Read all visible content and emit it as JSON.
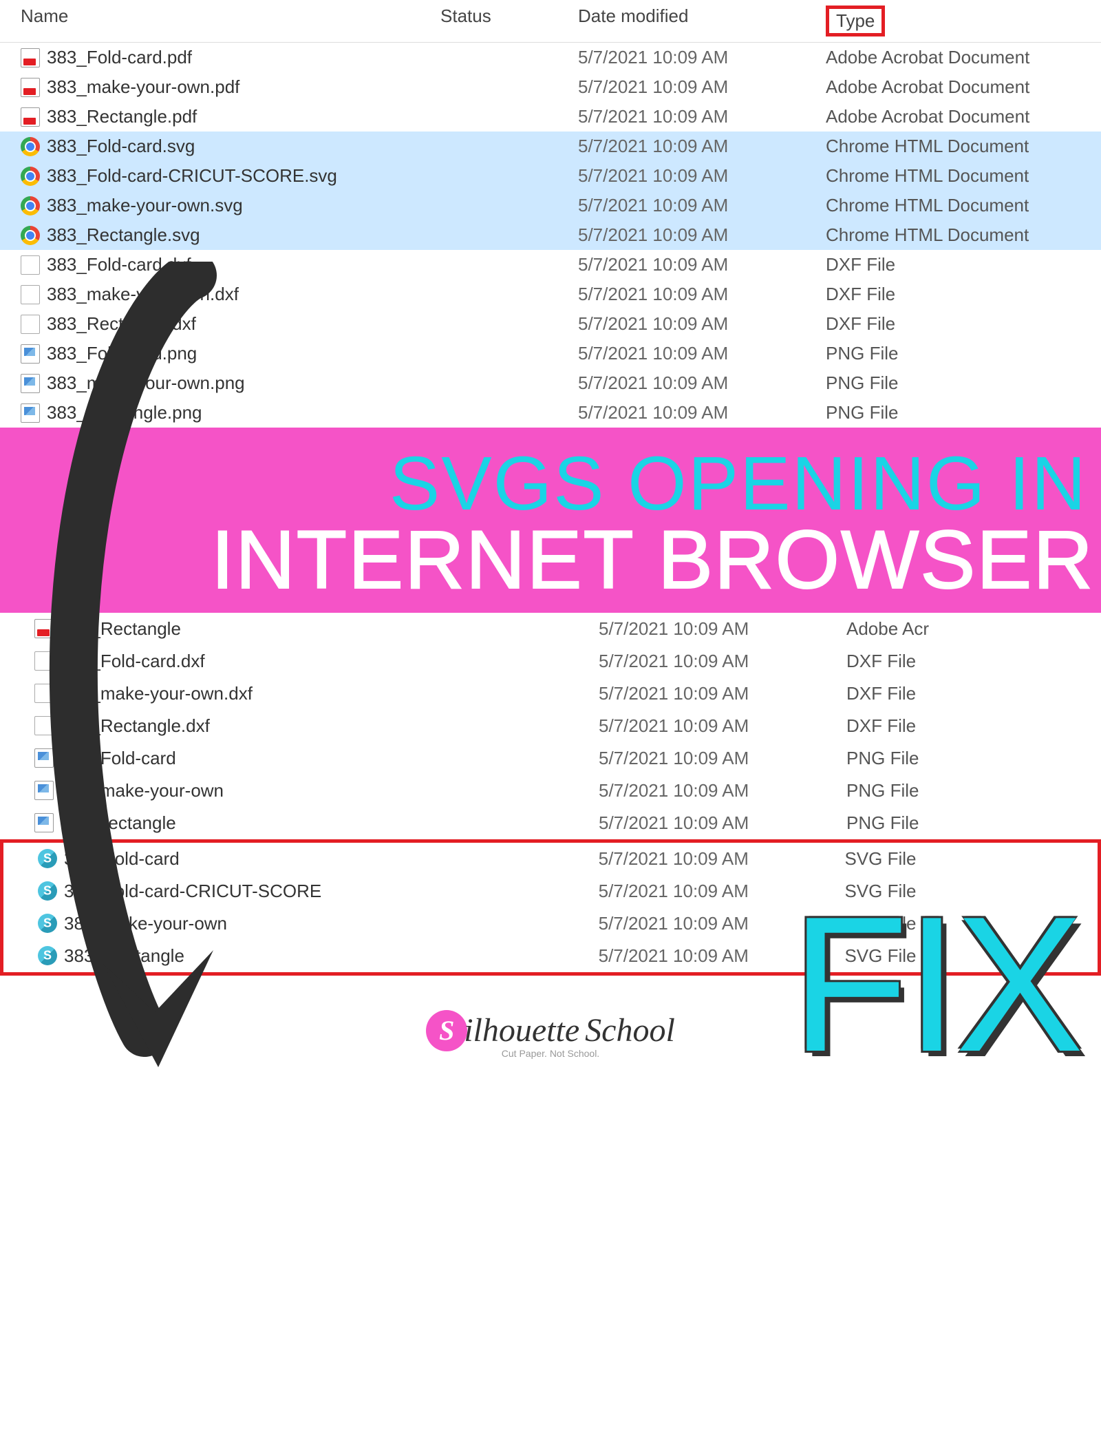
{
  "headers": {
    "name": "Name",
    "status": "Status",
    "date": "Date modified",
    "type": "Type"
  },
  "top_files": [
    {
      "icon": "pdf",
      "name": "383_Fold-card.pdf",
      "date": "5/7/2021 10:09 AM",
      "type": "Adobe Acrobat Document",
      "selected": false
    },
    {
      "icon": "pdf",
      "name": "383_make-your-own.pdf",
      "date": "5/7/2021 10:09 AM",
      "type": "Adobe Acrobat Document",
      "selected": false
    },
    {
      "icon": "pdf",
      "name": "383_Rectangle.pdf",
      "date": "5/7/2021 10:09 AM",
      "type": "Adobe Acrobat Document",
      "selected": false
    },
    {
      "icon": "chrome",
      "name": "383_Fold-card.svg",
      "date": "5/7/2021 10:09 AM",
      "type": "Chrome HTML Document",
      "selected": true
    },
    {
      "icon": "chrome",
      "name": "383_Fold-card-CRICUT-SCORE.svg",
      "date": "5/7/2021 10:09 AM",
      "type": "Chrome HTML Document",
      "selected": true
    },
    {
      "icon": "chrome",
      "name": "383_make-your-own.svg",
      "date": "5/7/2021 10:09 AM",
      "type": "Chrome HTML Document",
      "selected": true
    },
    {
      "icon": "chrome",
      "name": "383_Rectangle.svg",
      "date": "5/7/2021 10:09 AM",
      "type": "Chrome HTML Document",
      "selected": true
    },
    {
      "icon": "blank",
      "name": "383_Fold-card.dxf",
      "date": "5/7/2021 10:09 AM",
      "type": "DXF File",
      "selected": false
    },
    {
      "icon": "blank",
      "name": "383_make-your-own.dxf",
      "date": "5/7/2021 10:09 AM",
      "type": "DXF File",
      "selected": false
    },
    {
      "icon": "blank",
      "name": "383_Rectangle.dxf",
      "date": "5/7/2021 10:09 AM",
      "type": "DXF File",
      "selected": false
    },
    {
      "icon": "png",
      "name": "383_Fold-card.png",
      "date": "5/7/2021 10:09 AM",
      "type": "PNG File",
      "selected": false
    },
    {
      "icon": "png",
      "name": "383_make-your-own.png",
      "date": "5/7/2021 10:09 AM",
      "type": "PNG File",
      "selected": false
    },
    {
      "icon": "png",
      "name": "383_Rectangle.png",
      "date": "5/7/2021 10:09 AM",
      "type": "PNG File",
      "selected": false
    }
  ],
  "banner": {
    "line1": "SVGS OPENING IN",
    "line2": "INTERNET BROWSER",
    "fix": "FIX"
  },
  "bottom_files_upper": [
    {
      "icon": "pdf",
      "name": "383_Rectangle",
      "date": "5/7/2021 10:09 AM",
      "type": "Adobe Acr"
    },
    {
      "icon": "blank",
      "name": "383_Fold-card.dxf",
      "date": "5/7/2021 10:09 AM",
      "type": "DXF File"
    },
    {
      "icon": "blank",
      "name": "383_make-your-own.dxf",
      "date": "5/7/2021 10:09 AM",
      "type": "DXF File"
    },
    {
      "icon": "blank",
      "name": "383_Rectangle.dxf",
      "date": "5/7/2021 10:09 AM",
      "type": "DXF File"
    },
    {
      "icon": "png",
      "name": "383_Fold-card",
      "date": "5/7/2021 10:09 AM",
      "type": "PNG File"
    },
    {
      "icon": "png",
      "name": "383_make-your-own",
      "date": "5/7/2021 10:09 AM",
      "type": "PNG File"
    },
    {
      "icon": "png",
      "name": "383 Rectangle",
      "date": "5/7/2021 10:09 AM",
      "type": "PNG File"
    }
  ],
  "bottom_files_boxed": [
    {
      "icon": "svg",
      "name": "383_Fold-card",
      "date": "5/7/2021 10:09 AM",
      "type": "SVG File"
    },
    {
      "icon": "svg",
      "name": "383_Fold-card-CRICUT-SCORE",
      "date": "5/7/2021 10:09 AM",
      "type": "SVG File"
    },
    {
      "icon": "svg",
      "name": "383_make-your-own",
      "date": "5/7/2021 10:09 AM",
      "type": "SVG File"
    },
    {
      "icon": "svg",
      "name": "383_Rectangle",
      "date": "5/7/2021 10:09 AM",
      "type": "SVG File"
    }
  ],
  "logo": {
    "badge": "S",
    "brand1": "ilhouette",
    "brand2": "School",
    "tagline": "Cut Paper. Not School."
  }
}
